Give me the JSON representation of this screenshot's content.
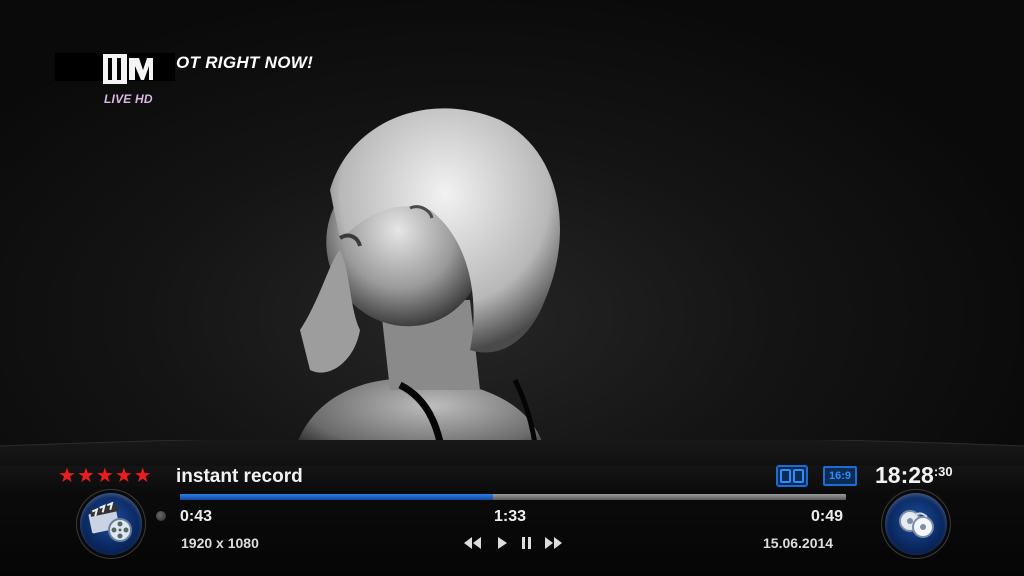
{
  "channel": {
    "logo_text": "MTV",
    "logo_sub": "LIVE HD",
    "slogan": "OT RIGHT NOW!"
  },
  "infobar": {
    "rating_stars": 5,
    "event_title": "instant record",
    "sound_icon": "dolby-icon",
    "aspect_label": "16:9",
    "clock_time": "18:28",
    "clock_seconds": ":30",
    "progress_fraction": 0.47,
    "elapsed": "0:43",
    "length": "1:33",
    "remaining": "0:49",
    "resolution": "1920 x 1080",
    "date": "15.06.2014",
    "controls": [
      "rewind-icon",
      "play-icon",
      "pause-icon",
      "fast-forward-icon"
    ],
    "left_orb_icon": "movie-clapper-reel-icon",
    "right_orb_icon": "film-reels-icon"
  },
  "colors": {
    "star": "#ee1c1c",
    "progress": "#1d63c8",
    "accent_blue": "#1d6cd1"
  }
}
